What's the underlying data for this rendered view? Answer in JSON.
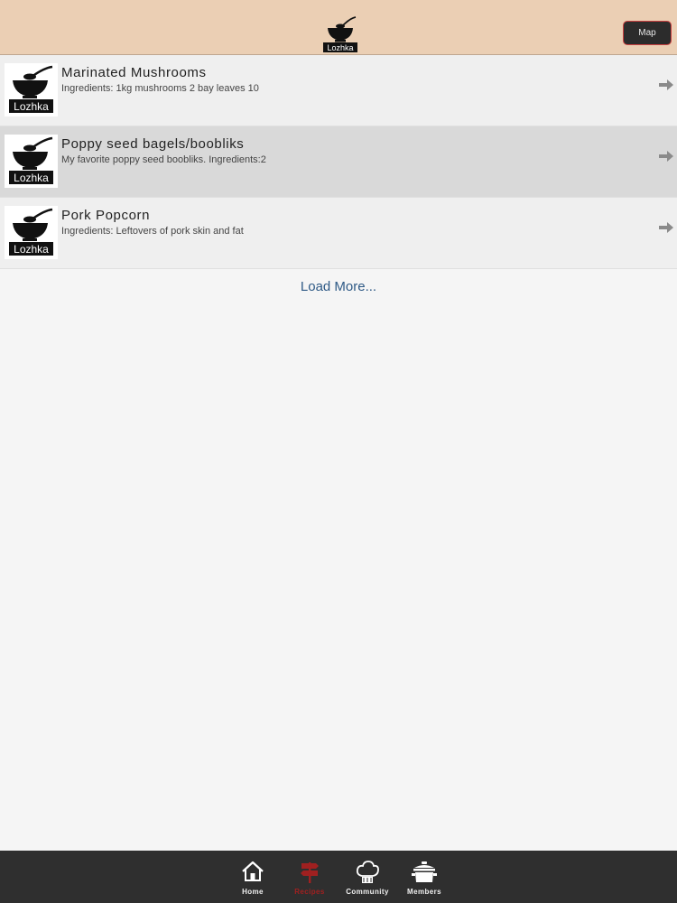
{
  "header": {
    "logo_text": "Lozhka",
    "map_button_label": "Map"
  },
  "recipes": [
    {
      "title": "Marinated Mushrooms",
      "description": "Ingredients: 1kg mushrooms 2 bay leaves 10",
      "thumb_text": "Lozhka",
      "arrow_icon": "right-arrow-icon"
    },
    {
      "title": "Poppy seed bagels/boobliks",
      "description": "My favorite poppy seed boobliks. Ingredients:2",
      "thumb_text": "Lozhka",
      "arrow_icon": "right-arrow-icon",
      "selected": true
    },
    {
      "title": "Pork Popcorn",
      "description": "Ingredients: Leftovers of pork skin and fat",
      "thumb_text": "Lozhka",
      "arrow_icon": "right-arrow-icon"
    }
  ],
  "load_more_label": "Load More...",
  "tabs": [
    {
      "label": "Home",
      "icon": "home-icon"
    },
    {
      "label": "Recipes",
      "icon": "signpost-icon",
      "active": true
    },
    {
      "label": "Community",
      "icon": "chef-hat-icon"
    },
    {
      "label": "Members",
      "icon": "pot-icon"
    }
  ],
  "colors": {
    "header_bg": "#ebcfb4",
    "tabbar_bg": "#2f2f2f",
    "active_tab": "#a02020",
    "link": "#2f5a86",
    "selected_row": "#d9d9d9"
  }
}
